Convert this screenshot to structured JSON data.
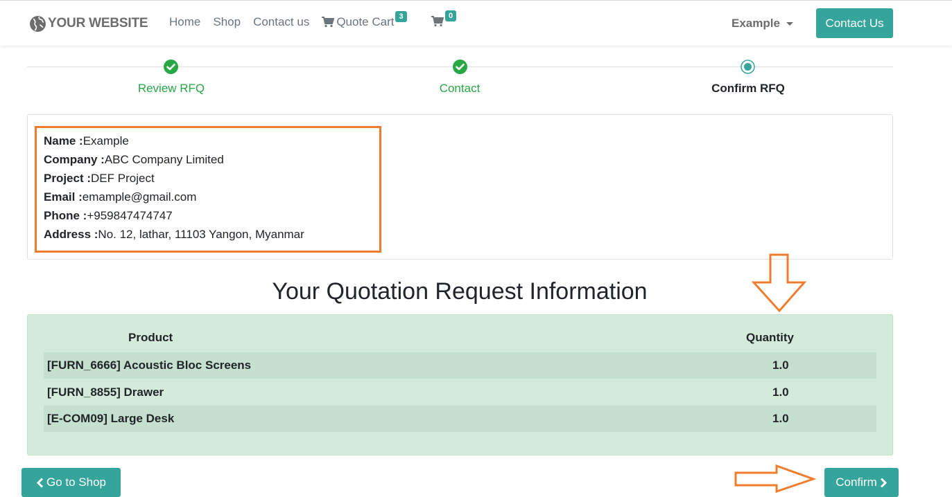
{
  "header": {
    "logo_text": "YOUR WEBSITE",
    "nav": [
      {
        "label": "Home"
      },
      {
        "label": "Shop"
      },
      {
        "label": "Contact us"
      },
      {
        "label": "Quote Cart",
        "badge": "3"
      }
    ],
    "cart_badge": "0",
    "user_menu": "Example",
    "contact_button": "Contact Us"
  },
  "steps": [
    {
      "label": "Review RFQ",
      "state": "done"
    },
    {
      "label": "Contact",
      "state": "done"
    },
    {
      "label": "Confirm RFQ",
      "state": "current"
    }
  ],
  "customer": {
    "name_label": "Name :",
    "name": "Example",
    "company_label": "Company :",
    "company": "ABC Company Limited",
    "project_label": "Project :",
    "project": "DEF Project",
    "email_label": "Email :",
    "email": "emample@gmail.com",
    "phone_label": "Phone :",
    "phone": "+959847474747",
    "address_label": "Address :",
    "address": "No. 12, lathar, 11103 Yangon, Myanmar"
  },
  "quotation": {
    "title": "Your Quotation Request Information",
    "columns": [
      "Product",
      "Quantity"
    ],
    "rows": [
      {
        "product": "[FURN_6666] Acoustic Bloc Screens",
        "quantity": "1.0"
      },
      {
        "product": "[FURN_8855] Drawer",
        "quantity": "1.0"
      },
      {
        "product": "[E-COM09] Large Desk",
        "quantity": "1.0"
      }
    ]
  },
  "actions": {
    "back_label": "Go to Shop",
    "confirm_label": "Confirm"
  },
  "colors": {
    "accent": "#35a59c",
    "success": "#28a745",
    "annotation": "#f07d2e",
    "table_bg": "#d4ebdb"
  }
}
